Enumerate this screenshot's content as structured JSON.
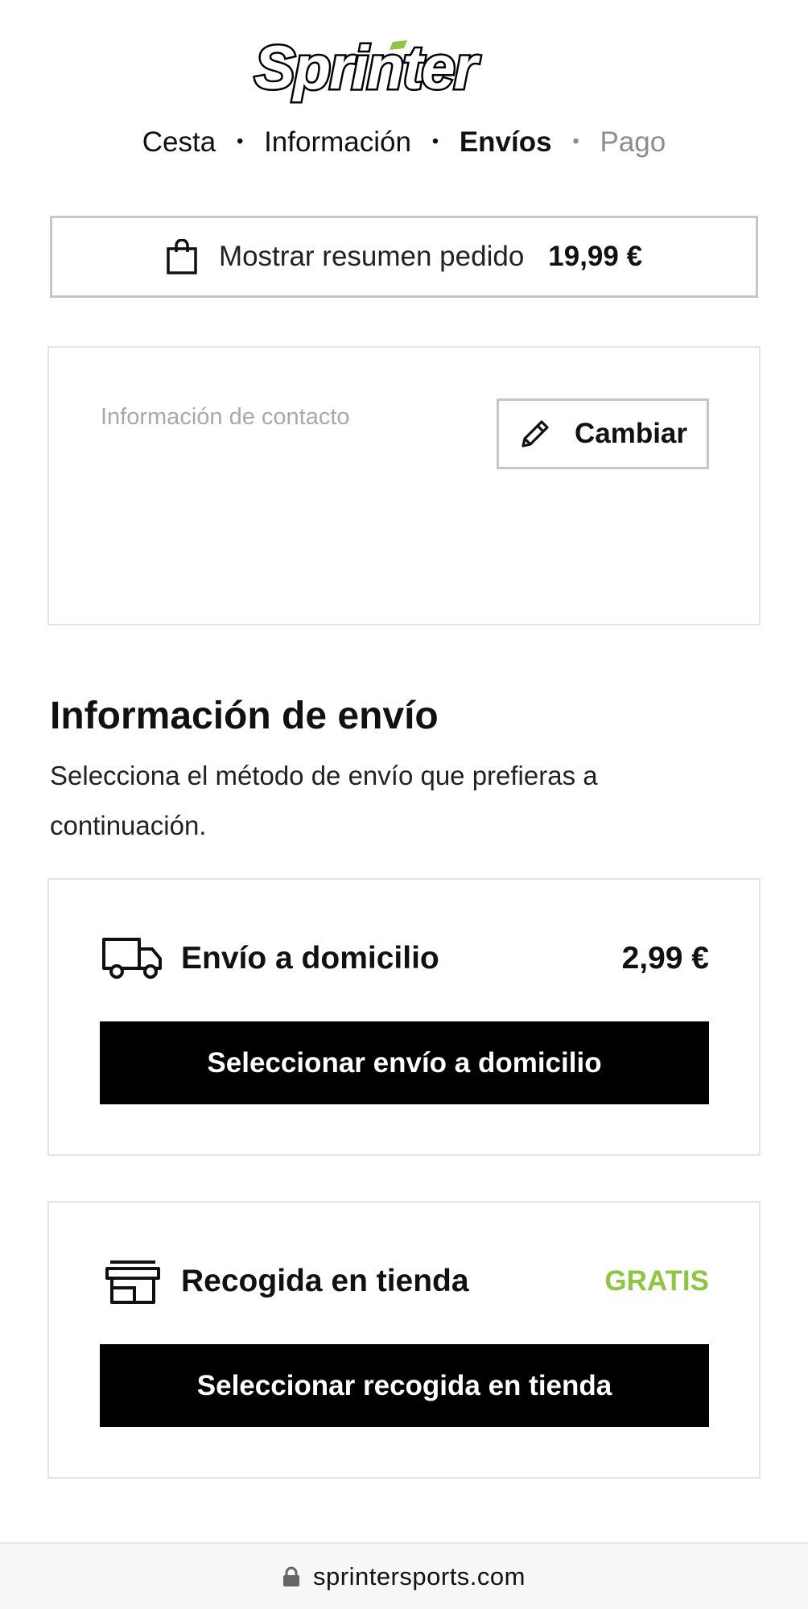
{
  "brand": {
    "name": "Sprinter",
    "accent": "#8dc63f"
  },
  "breadcrumb": {
    "steps": [
      "Cesta",
      "Información",
      "Envíos",
      "Pago"
    ],
    "current": "Envíos"
  },
  "summary": {
    "label": "Mostrar resumen pedido",
    "total": "19,99 €",
    "icon": "shopping-bag-icon"
  },
  "contact": {
    "label": "Información de contacto",
    "change_label": "Cambiar",
    "icon": "pencil-icon"
  },
  "shipping": {
    "title": "Información de envío",
    "description": "Selecciona el método de envío que prefieras a continuación.",
    "options": [
      {
        "name": "Envío a domicilio",
        "price": "2,99 €",
        "button": "Seleccionar envío a domicilio",
        "icon": "truck-icon"
      },
      {
        "name": "Recogida en tienda",
        "price": "GRATIS",
        "button": "Seleccionar recogida en tienda",
        "icon": "store-icon"
      }
    ]
  },
  "browser": {
    "url": "sprintersports.com",
    "icon": "lock-icon"
  }
}
